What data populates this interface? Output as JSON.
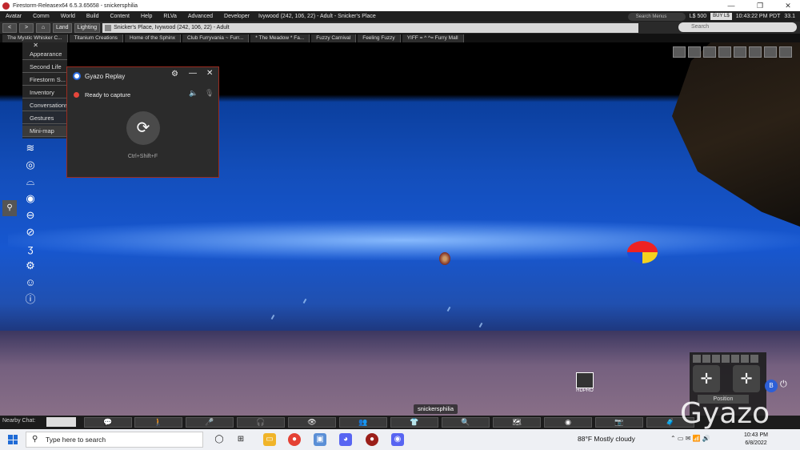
{
  "window": {
    "title": "Firestorm-Releasex64 6.5.3.65658 - snickersphilia",
    "controls": [
      "—",
      "❐",
      "✕"
    ]
  },
  "menubar": {
    "items": [
      "Avatar",
      "Comm",
      "World",
      "Build",
      "Content",
      "Help",
      "RLVa",
      "Advanced",
      "Developer"
    ],
    "location": "Ivywood (242, 106, 22) - Adult - Snicker's Place",
    "search_placeholder": "Search Menus",
    "balance": "L$ 500",
    "buy_label": "BUY L$",
    "time": "10:43:22 PM PDT",
    "fps": "33.1"
  },
  "navbar": {
    "back": "<",
    "forward": ">",
    "home_icon": "home-icon",
    "land": "Land",
    "lighting": "Lighting",
    "url": "Snicker's Place, Ivywood (242, 106, 22) - Adult",
    "search_placeholder": "Search"
  },
  "favorites": [
    "The Mystic Whisker C...",
    "Titanium Creations",
    "Home of the Sphinx",
    "Club Furryvania ~ Furr...",
    "* The Meadow *  Fa...",
    "Fuzzy Carnival",
    "Feeling Fuzzy",
    "YIFF = ^ ^= Furry Mall"
  ],
  "left_panel": {
    "items": [
      "Appearance",
      "Second Life",
      "Firestorm S...",
      "Inventory",
      "Conversations",
      "Gestures",
      "Mini-map"
    ]
  },
  "gyazo": {
    "title": "Gyazo Replay",
    "status": "Ready to capture",
    "shortcut": "Ctrl+Shift+F",
    "watermark": "Gyazo"
  },
  "movement": {
    "position_label": "Position",
    "b_label": "B"
  },
  "avatar_name": "snickersphilia",
  "hud": {
    "hdpro": "HDPRO"
  },
  "bottombar": {
    "nearby_chat": "Nearby Chat:"
  },
  "taskbar": {
    "search_placeholder": "Type here to search",
    "weather": "88°F  Mostly cloudy",
    "time": "10:43 PM",
    "date": "6/8/2022"
  }
}
